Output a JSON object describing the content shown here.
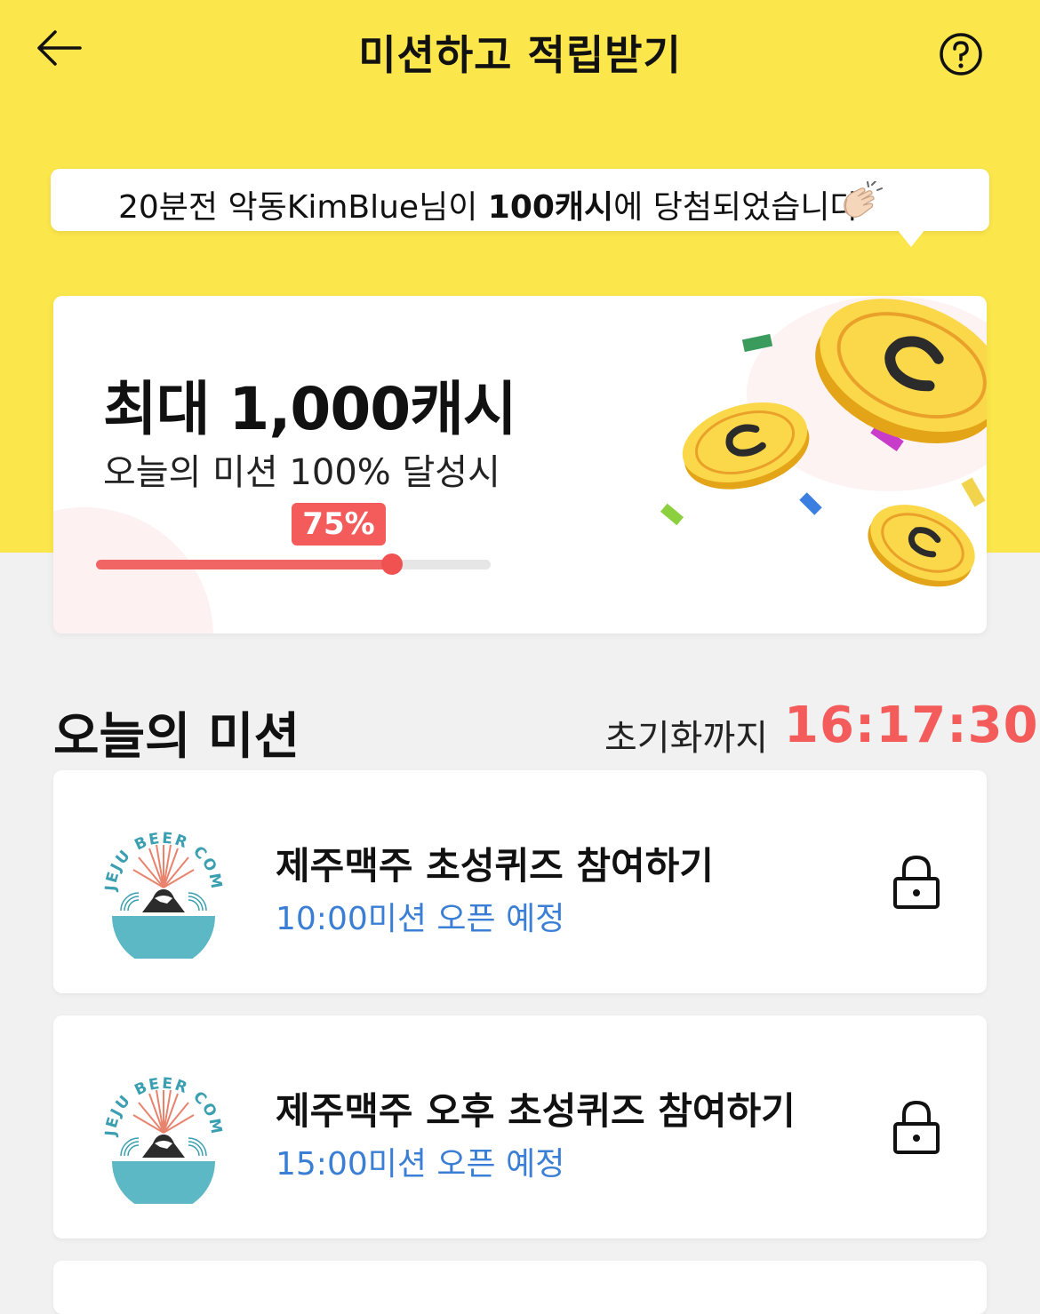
{
  "header": {
    "title": "미션하고 적립받기"
  },
  "winner": {
    "prefix": "20분전 악동KimBlue님이 ",
    "amount": "100캐시",
    "suffix": "에 당첨되었습니다"
  },
  "reward": {
    "title": "최대 1,000캐시",
    "subtitle": "오늘의 미션 100% 달성시",
    "progress_label": "75%",
    "progress": 0.75
  },
  "missions_section": {
    "heading": "오늘의 미션",
    "reset_label": "초기화까지",
    "reset_timer": "16:17:30"
  },
  "missions": [
    {
      "title": "제주맥주 초성퀴즈 참여하기",
      "status": "10:00미션 오픈 예정",
      "logo_text": "JEJU BEER COMPANY"
    },
    {
      "title": "제주맥주 오후 초성퀴즈 참여하기",
      "status": "15:00미션 오픈 예정",
      "logo_text": "JEJU BEER COMPANY"
    }
  ],
  "colors": {
    "brand_yellow": "#fbe64b",
    "accent_red": "#f45b5b",
    "status_blue": "#3a7fd5"
  }
}
